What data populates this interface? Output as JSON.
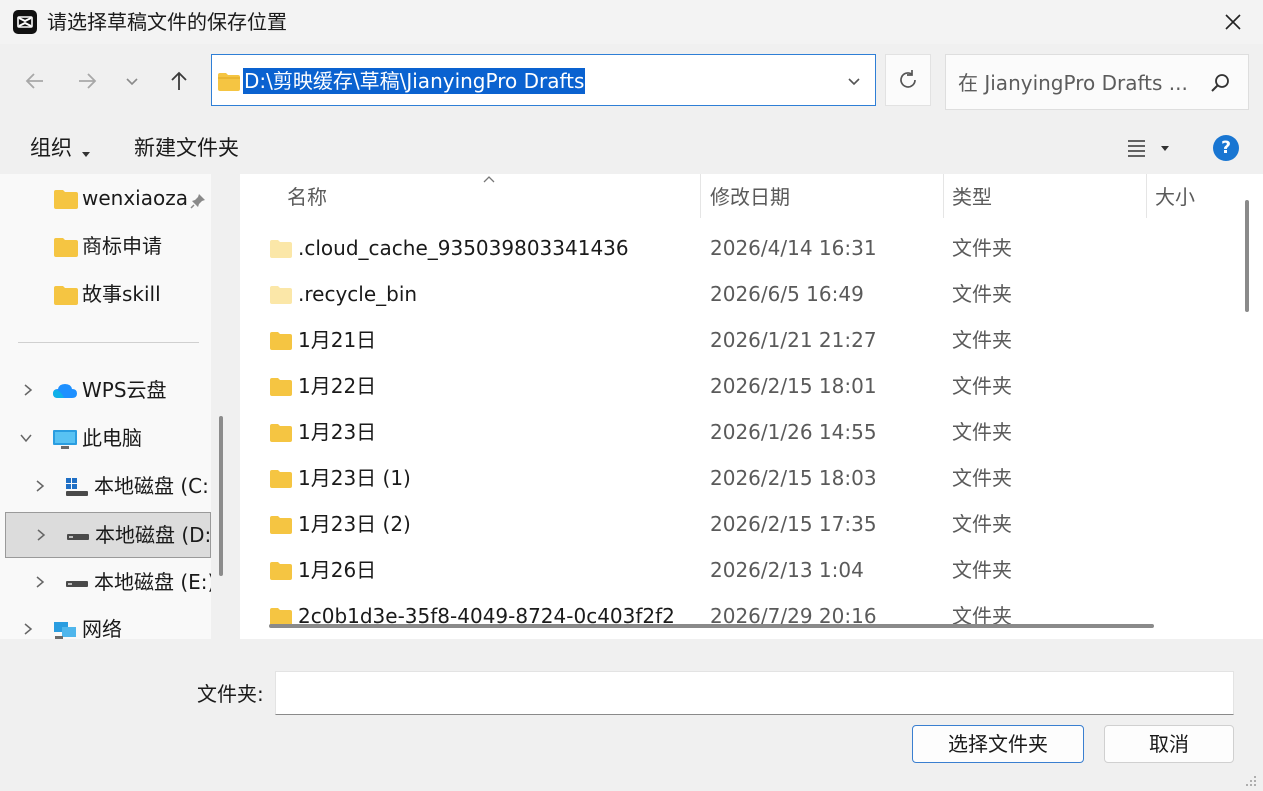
{
  "window": {
    "title": "请选择草稿文件的保存位置"
  },
  "address": {
    "path": "D:\\剪映缓存\\草稿\\JianyingPro Drafts"
  },
  "search": {
    "placeholder": "在 JianyingPro Drafts ..."
  },
  "toolbar": {
    "organize": "组织",
    "new_folder": "新建文件夹"
  },
  "nav": {
    "items": [
      {
        "label": "wenxiaoza",
        "icon": "folder-icon",
        "pinned": true
      },
      {
        "label": "商标申请",
        "icon": "folder-icon"
      },
      {
        "label": "故事skill",
        "icon": "folder-icon"
      },
      {
        "label": "WPS云盘",
        "icon": "cloud-icon"
      },
      {
        "label": "此电脑",
        "icon": "pc-icon",
        "expanded": true
      },
      {
        "label": "本地磁盘 (C:",
        "icon": "drive-c-icon"
      },
      {
        "label": "本地磁盘 (D:",
        "icon": "drive-icon",
        "selected": true
      },
      {
        "label": "本地磁盘 (E:)",
        "icon": "drive-icon"
      },
      {
        "label": "网络",
        "icon": "network-icon"
      }
    ]
  },
  "columns": {
    "name": "名称",
    "modified": "修改日期",
    "type": "类型",
    "size": "大小"
  },
  "files": [
    {
      "name": ".cloud_cache_935039803341436",
      "modified": "2026/4/14 16:31",
      "type": "文件夹",
      "hidden": true
    },
    {
      "name": ".recycle_bin",
      "modified": "2026/6/5 16:49",
      "type": "文件夹",
      "hidden": true
    },
    {
      "name": "1月21日",
      "modified": "2026/1/21 21:27",
      "type": "文件夹"
    },
    {
      "name": "1月22日",
      "modified": "2026/2/15 18:01",
      "type": "文件夹"
    },
    {
      "name": "1月23日",
      "modified": "2026/1/26 14:55",
      "type": "文件夹"
    },
    {
      "name": "1月23日 (1)",
      "modified": "2026/2/15 18:03",
      "type": "文件夹"
    },
    {
      "name": "1月23日 (2)",
      "modified": "2026/2/15 17:35",
      "type": "文件夹"
    },
    {
      "name": "1月26日",
      "modified": "2026/2/13 1:04",
      "type": "文件夹"
    },
    {
      "name": "2c0b1d3e-35f8-4049-8724-0c403f2f2",
      "modified": "2026/7/29 20:16",
      "type": "文件夹"
    }
  ],
  "footer": {
    "folder_label": "文件夹:",
    "folder_value": "",
    "select_button": "选择文件夹",
    "cancel_button": "取消"
  },
  "colors": {
    "accent": "#0a62d0",
    "folder": "#f5c542",
    "help": "#1976d2"
  }
}
